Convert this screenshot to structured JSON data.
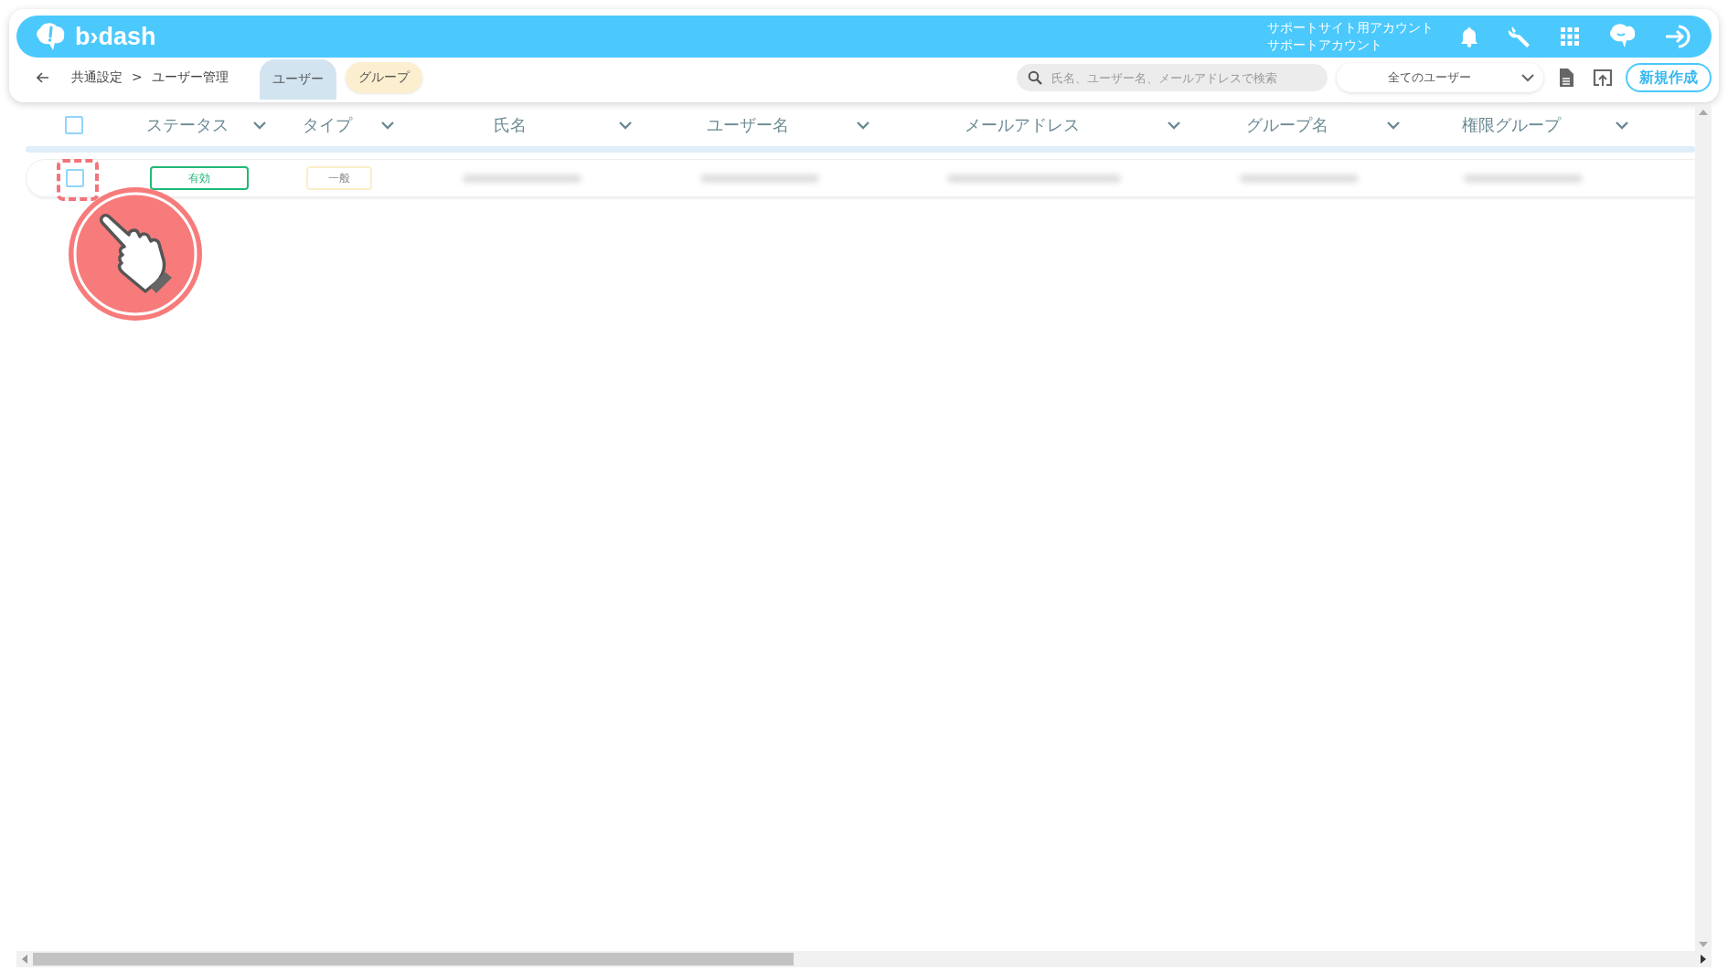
{
  "header": {
    "logo": "b›dash",
    "account_site": "サポートサイト用アカウント",
    "account_name": "サポートアカウント"
  },
  "breadcrumb": {
    "items": [
      "共通設定",
      "ユーザー管理"
    ],
    "separator": ">"
  },
  "tabs": [
    {
      "label": "ユーザー",
      "selected": true
    },
    {
      "label": "グループ",
      "selected": false
    }
  ],
  "search": {
    "placeholder": "氏名、ユーザー名、メールアドレスで検索"
  },
  "filter": {
    "value": "全てのユーザー"
  },
  "new_button": "新規作成",
  "table": {
    "select_all_checked": false,
    "columns": [
      "ステータス",
      "タイプ",
      "氏名",
      "ユーザー名",
      "メールアドレス",
      "グループ名",
      "権限グループ"
    ],
    "rows": [
      {
        "checked": false,
        "highlighted": true,
        "status": "有効",
        "type": "一般"
      }
    ]
  }
}
